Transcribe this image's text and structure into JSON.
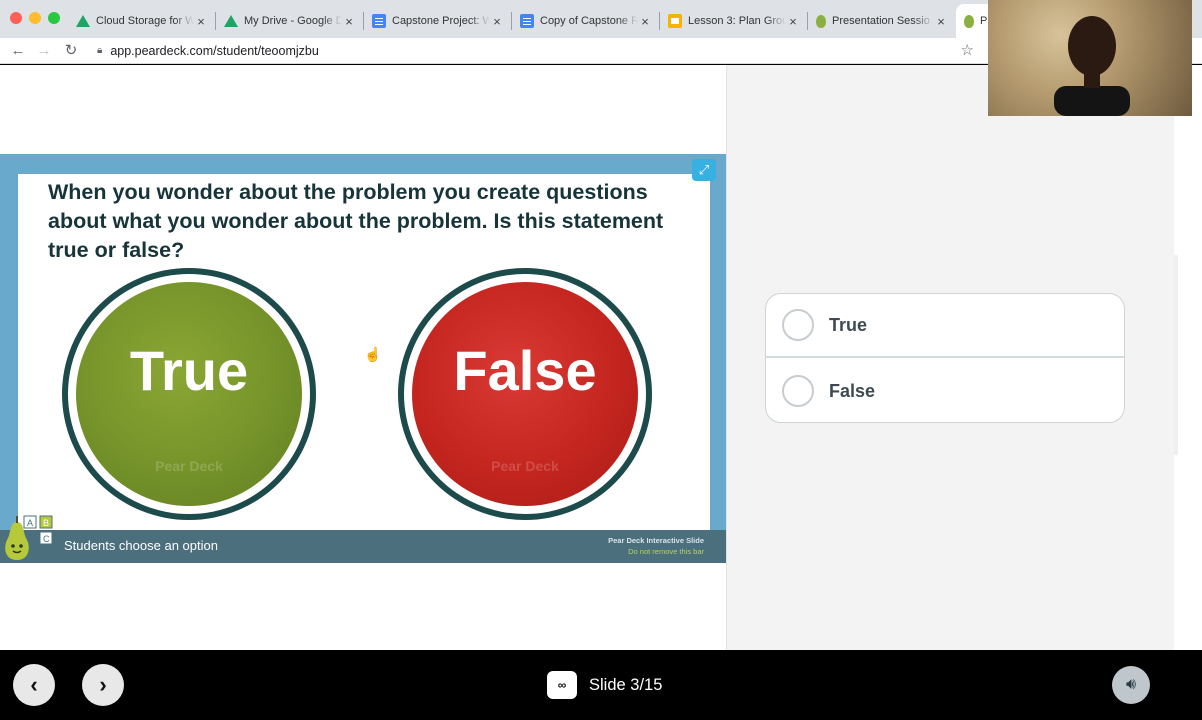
{
  "browser": {
    "tabs": [
      {
        "title": "Cloud Storage for W",
        "icon": "drive-icon"
      },
      {
        "title": "My Drive - Google D",
        "icon": "drive-icon"
      },
      {
        "title": "Capstone Project: W",
        "icon": "docs-icon"
      },
      {
        "title": "Copy of Capstone R",
        "icon": "docs-icon"
      },
      {
        "title": "Lesson 3: Plan Grou",
        "icon": "slides-icon"
      },
      {
        "title": "Presentation Sessio",
        "icon": "peardeck-icon"
      },
      {
        "title": "P",
        "icon": "peardeck-icon"
      }
    ],
    "url": "app.peardeck.com/student/teoomjzbu"
  },
  "slide": {
    "question": "When you wonder about the problem you create questions about what you wonder about the problem. Is this statement true or false?",
    "true_label": "True",
    "false_label": "False",
    "watermark": "Pear Deck",
    "footer_text": "Students choose an option",
    "footer_note_1": "Pear Deck Interactive Slide",
    "footer_note_2": "Do not remove this bar"
  },
  "answers": [
    {
      "label": "True"
    },
    {
      "label": "False"
    }
  ],
  "bottom_bar": {
    "slide_counter": "Slide 3/15"
  },
  "colors": {
    "true_green": "#75932a",
    "false_red": "#c4251f",
    "frame_blue": "#68a9cc",
    "footer_slate": "#4c6f7d"
  }
}
